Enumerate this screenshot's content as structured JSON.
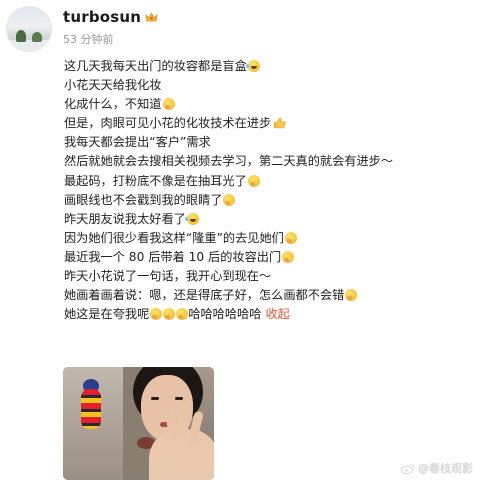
{
  "post": {
    "username": "turbosun",
    "timestamp": "53 分钟前",
    "lines": [
      {
        "text": "这几天我每天出门的妆容都是盲盒",
        "emoji": "laughing-tears-emoji"
      },
      {
        "text": "小花天天给我化妆",
        "emoji": ""
      },
      {
        "text": "化成什么，不知道",
        "emoji": "thinking-emoji"
      },
      {
        "text": "但是，肉眼可见小花的化妆技术在进步",
        "emoji": "thumbs-up-emoji"
      },
      {
        "text": "我每天都会提出“客户”需求",
        "emoji": ""
      },
      {
        "text": "然后就她就会去搜相关视频去学习，第二天真的就会有进步～",
        "emoji": ""
      },
      {
        "text": "最起码，打粉底不像是在抽耳光了",
        "emoji": "thinking-emoji"
      },
      {
        "text": "画眼线也不会戳到我的眼睛了",
        "emoji": "thinking-emoji"
      },
      {
        "text": "昨天朋友说我太好看了",
        "emoji": "laughing-tears-emoji"
      },
      {
        "text": "因为她们很少看我这样“隆重”的去见她们",
        "emoji": "thinking-emoji"
      },
      {
        "text": "最近我一个 80 后带着 10 后的妆容出门",
        "emoji": "thinking-emoji"
      },
      {
        "text": "昨天小花说了一句话，我开心到现在～",
        "emoji": ""
      },
      {
        "text": "她画着画着说：嗯，还是得底子好，怎么画都不会错",
        "emoji": "thinking-emoji"
      },
      {
        "text": "她这是在夸我呢",
        "emoji": "thinking-emoji-x3"
      }
    ],
    "last_line_suffix": "哈哈哈哈哈哈",
    "collapse_label": "收起",
    "watermark": "@春枝观影"
  },
  "colors": {
    "username": "#1a1a1a",
    "timestamp": "#9a9a9a",
    "body_text": "#222222",
    "collapse_link": "#e8542e",
    "crown": "#f2b330"
  }
}
